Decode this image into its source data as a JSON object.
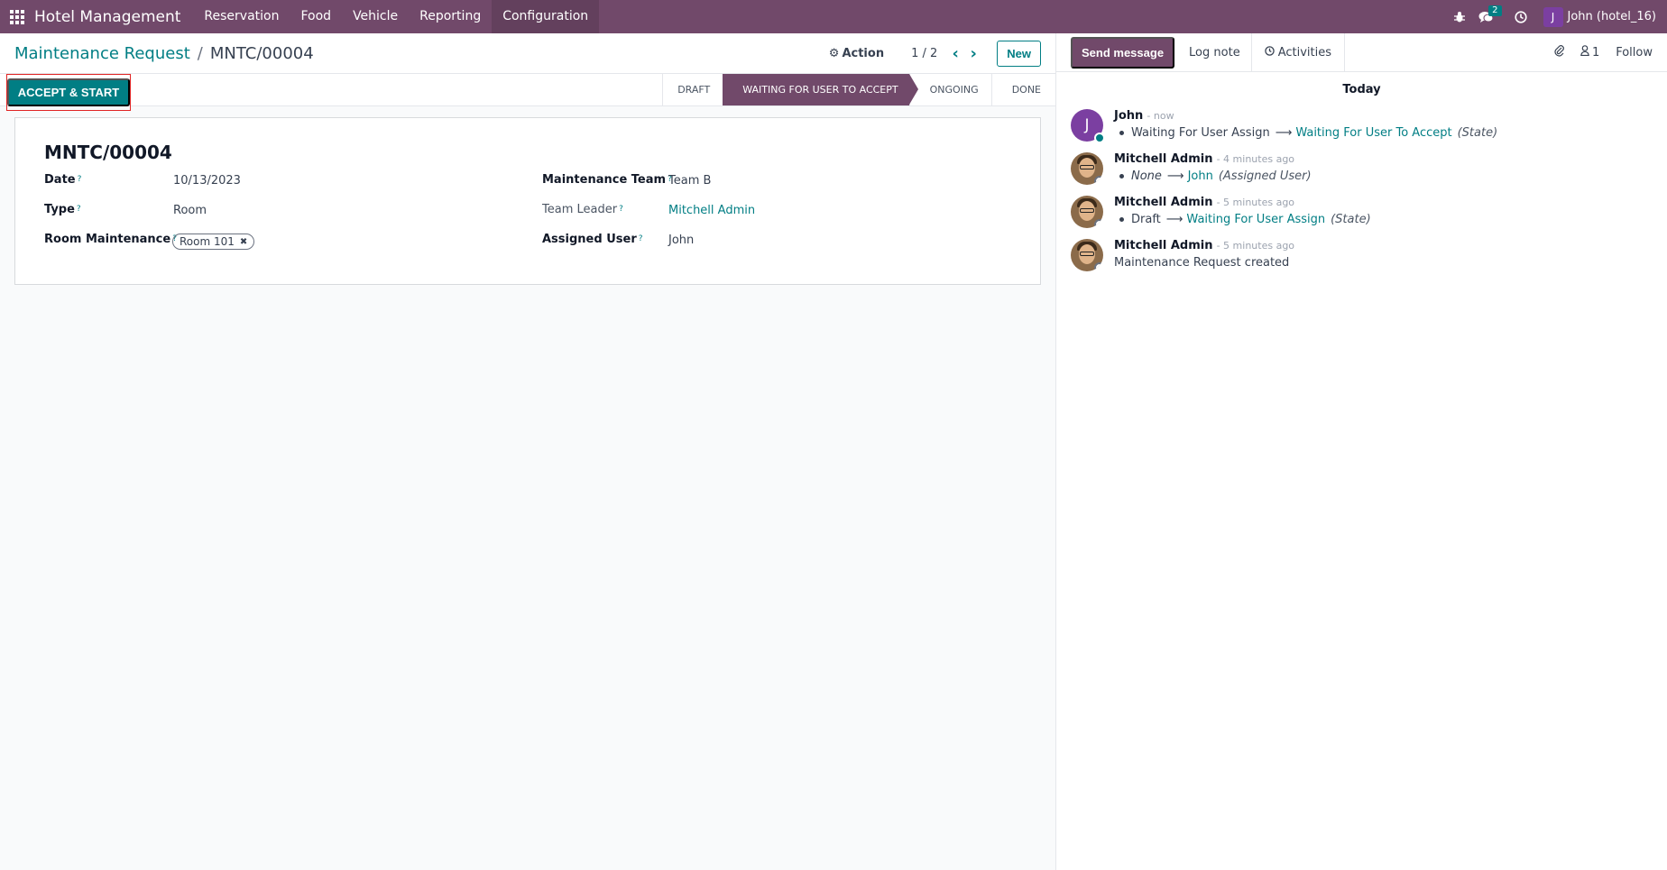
{
  "navbar": {
    "app_name": "Hotel Management",
    "menu": [
      "Reservation",
      "Food",
      "Vehicle",
      "Reporting",
      "Configuration"
    ],
    "messages_badge": "2",
    "user_initial": "J",
    "user_name": "John (hotel_16)"
  },
  "control_panel": {
    "breadcrumb_parent": "Maintenance Request",
    "breadcrumb_separator": "/",
    "breadcrumb_current": "MNTC/00004",
    "action_label": "Action",
    "pager": "1 / 2",
    "new_label": "New"
  },
  "statusbar": {
    "primary_button": "ACCEPT & START",
    "stages": [
      "DRAFT",
      "WAITING FOR USER TO ACCEPT",
      "ONGOING",
      "DONE"
    ],
    "active_stage": "WAITING FOR USER TO ACCEPT"
  },
  "form": {
    "title": "MNTC/00004",
    "help_mark": "?",
    "date_label": "Date",
    "date_value": "10/13/2023",
    "type_label": "Type",
    "type_value": "Room",
    "room_label": "Room Maintenance",
    "room_tag": "Room 101",
    "team_label": "Maintenance Team",
    "team_value": "Team B",
    "leader_label": "Team Leader",
    "leader_value": "Mitchell Admin",
    "user_label": "Assigned User",
    "user_value": "John"
  },
  "chatter": {
    "send_message": "Send message",
    "log_note": "Log note",
    "activities": "Activities",
    "followers_count": "1",
    "follow": "Follow",
    "today": "Today",
    "messages": [
      {
        "author": "John",
        "time": "- now",
        "old": "Waiting For User Assign",
        "new": "Waiting For User To Accept",
        "field": "(State)"
      },
      {
        "author": "Mitchell Admin",
        "time": "- 4 minutes ago",
        "old": "None",
        "new": "John",
        "field": "(Assigned User)"
      },
      {
        "author": "Mitchell Admin",
        "time": "- 5 minutes ago",
        "old": "Draft",
        "new": "Waiting For User Assign",
        "field": "(State)"
      },
      {
        "author": "Mitchell Admin",
        "time": "- 5 minutes ago",
        "text": "Maintenance Request created"
      }
    ]
  }
}
